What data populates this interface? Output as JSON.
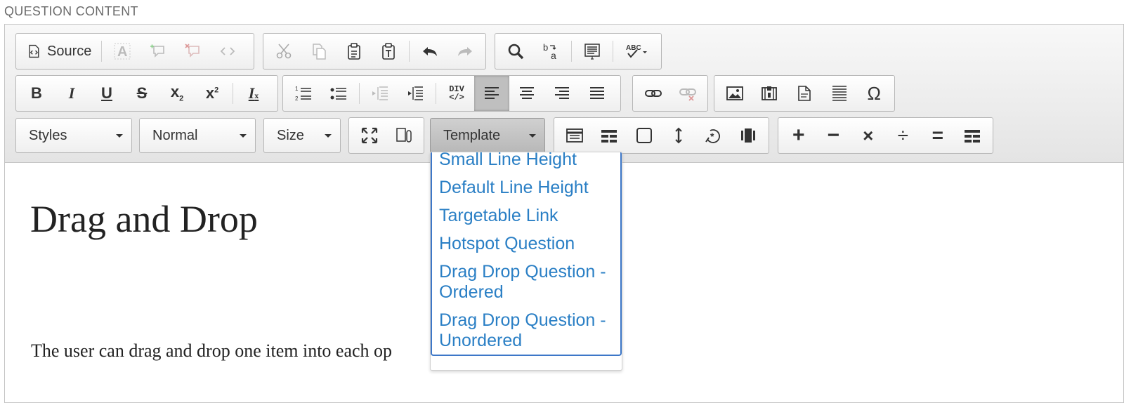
{
  "section_label": "QUESTION CONTENT",
  "toolbar": {
    "source_label": "Source",
    "styles_label": "Styles",
    "format_label": "Normal",
    "size_label": "Size",
    "template_label": "Template",
    "div_label": "DIV"
  },
  "template_menu": {
    "items": [
      "Small Line Height",
      "Default Line Height",
      "Targetable Link",
      "Hotspot Question",
      "Drag Drop Question - Ordered",
      "Drag Drop Question - Unordered"
    ]
  },
  "content": {
    "title": "Drag and Drop",
    "paragraph": "The user can drag and drop one item into each op"
  },
  "colors": {
    "link": "#2a7fc5",
    "menu_border": "#3d77c8",
    "toolbar_bg": "#eeeeee"
  }
}
